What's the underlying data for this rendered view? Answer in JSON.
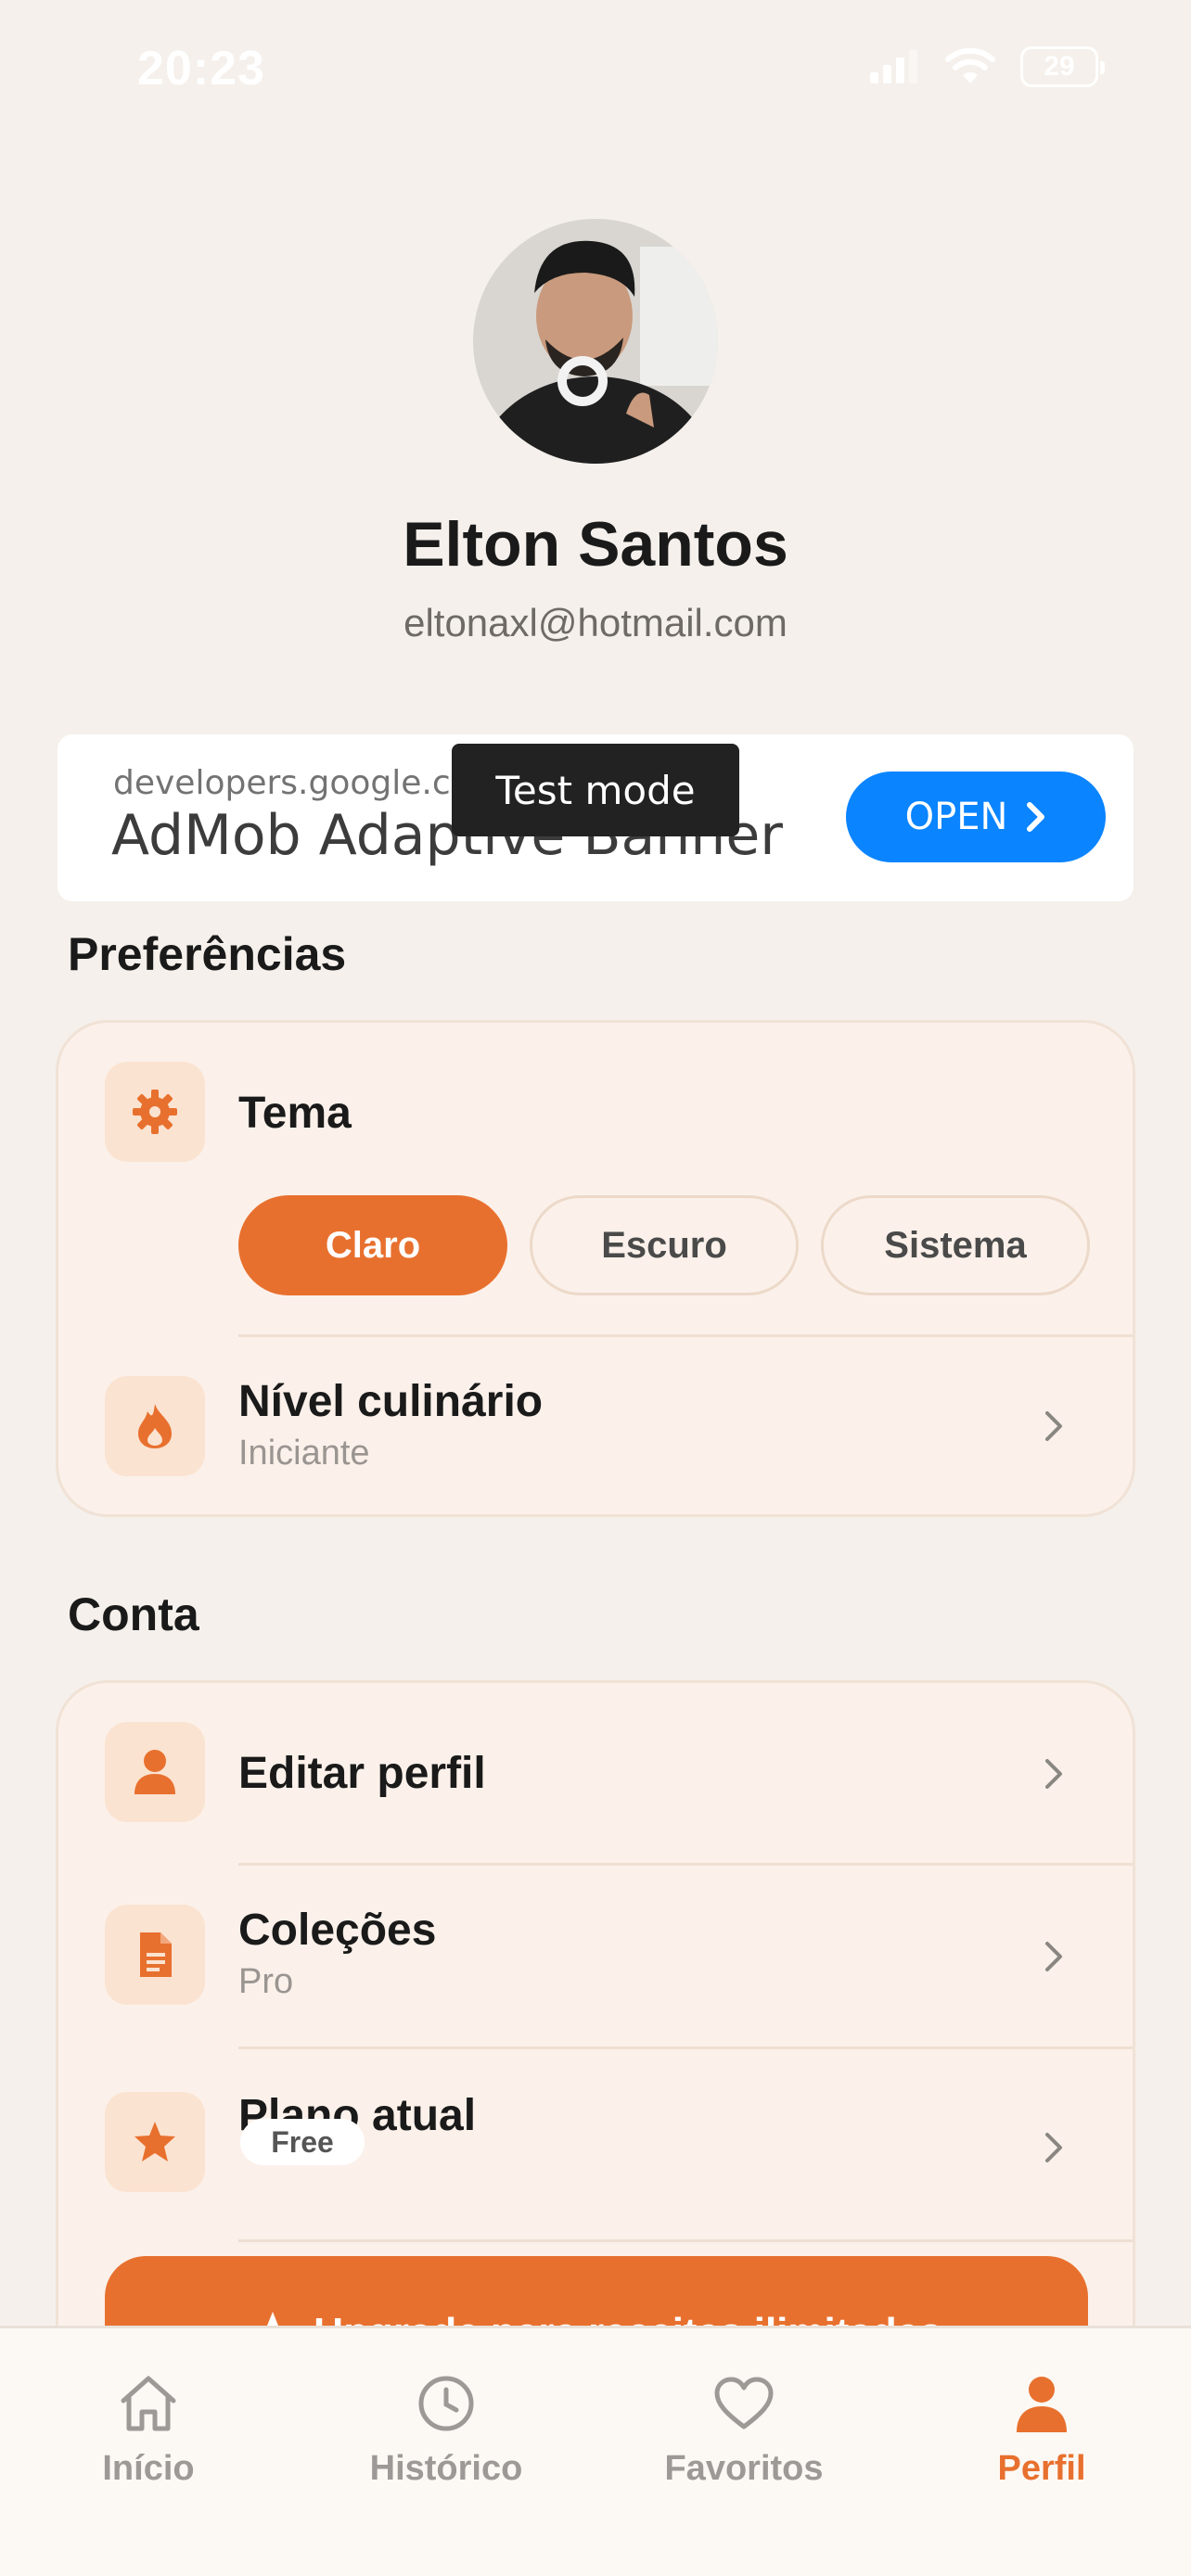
{
  "status_bar": {
    "time": "20:23",
    "battery": "29"
  },
  "profile": {
    "name": "Elton Santos",
    "email": "eltonaxl@hotmail.com"
  },
  "ad": {
    "domain": "developers.google.co",
    "title": "AdMob Adaptive Banner",
    "open_label": "OPEN",
    "test_mode_label": "Test mode"
  },
  "preferences": {
    "title": "Preferências",
    "theme": {
      "label": "Tema",
      "options": [
        "Claro",
        "Escuro",
        "Sistema"
      ],
      "selected": "Claro"
    },
    "cooking_level": {
      "label": "Nível culinário",
      "value": "Iniciante"
    }
  },
  "account": {
    "title": "Conta",
    "items": [
      {
        "label": "Editar perfil"
      },
      {
        "label": "Coleções",
        "sub": "Pro"
      },
      {
        "label": "Plano atual",
        "badge": "Free"
      }
    ],
    "upgrade_label": "Upgrade para receitas ilimitadas"
  },
  "tabs": [
    {
      "label": "Início",
      "icon": "home-icon"
    },
    {
      "label": "Histórico",
      "icon": "clock-icon"
    },
    {
      "label": "Favoritos",
      "icon": "heart-icon"
    },
    {
      "label": "Perfil",
      "icon": "user-icon",
      "active": true
    }
  ],
  "colors": {
    "accent": "#e8702e",
    "background": "#f5f0eb",
    "ad_button": "#0a84ff"
  }
}
